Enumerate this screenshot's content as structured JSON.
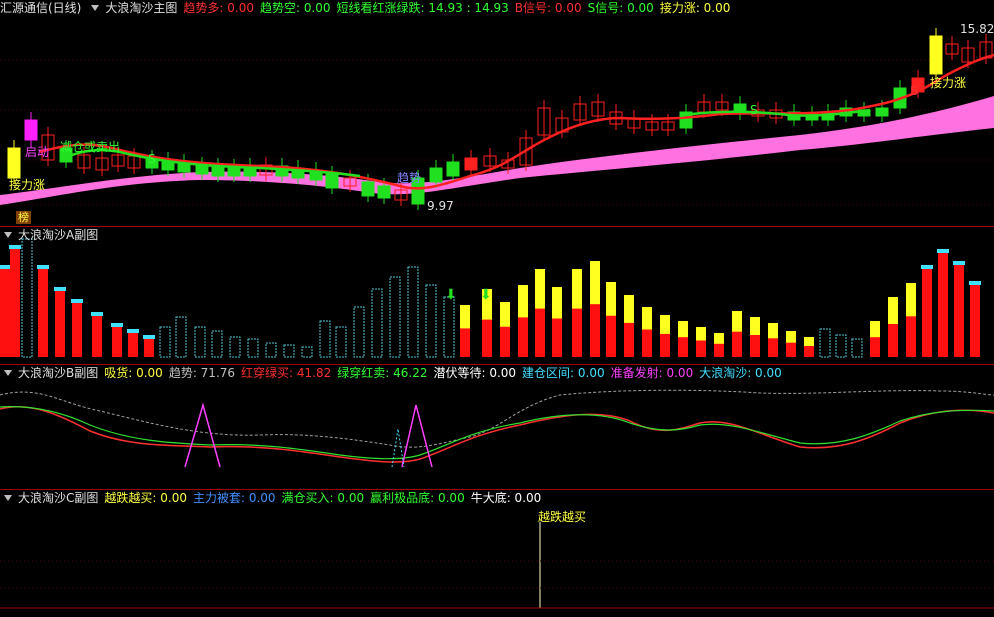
{
  "main": {
    "title": "汇源通信(日线)",
    "indicator": "大浪淘沙主图",
    "fields": [
      {
        "label": "趋势多:",
        "value": "0.00",
        "color": "#ff3030"
      },
      {
        "label": "趋势空:",
        "value": "0.00",
        "color": "#30ff30"
      },
      {
        "label": "短线看红涨绿跌:",
        "value": "14.93 : 14.93",
        "color": "#30ff30"
      },
      {
        "label": "B信号:",
        "value": "0.00",
        "color": "#ff3030"
      },
      {
        "label": "S信号:",
        "value": "0.00",
        "color": "#30ff30"
      },
      {
        "label": "接力涨:",
        "value": "0.00",
        "color": "#ffff40"
      }
    ],
    "annotations": {
      "jieli1": "接力涨",
      "jieli2": "接力涨",
      "qidong": "启动",
      "jiancang": "减仓或卖出",
      "qushi": "趋势",
      "bang": "榜",
      "low_price": "9.97",
      "high_price": "15.82",
      "b_mark": "B",
      "s_mark1": "S",
      "s_mark2": "S"
    }
  },
  "sub_a": {
    "title": "大浪淘沙A副图"
  },
  "sub_b": {
    "title": "大浪淘沙B副图",
    "fields": [
      {
        "label": "吸货:",
        "value": "0.00",
        "color": "#ffff40"
      },
      {
        "label": "趋势:",
        "value": "71.76",
        "color": "#c0c0c0"
      },
      {
        "label": "红穿绿买:",
        "value": "41.82",
        "color": "#ff3030"
      },
      {
        "label": "绿穿红卖:",
        "value": "46.22",
        "color": "#30ff30"
      },
      {
        "label": "潜伏等待:",
        "value": "0.00",
        "color": "#ffffff"
      },
      {
        "label": "建仓区间:",
        "value": "0.00",
        "color": "#40e0ff"
      },
      {
        "label": "准备发射:",
        "value": "0.00",
        "color": "#ff40ff"
      },
      {
        "label": "大浪淘沙:",
        "value": "0.00",
        "color": "#40e0ff"
      }
    ]
  },
  "sub_c": {
    "title": "大浪淘沙C副图",
    "fields": [
      {
        "label": "越跌越买:",
        "value": "0.00",
        "color": "#ffff40"
      },
      {
        "label": "主力被套:",
        "value": "0.00",
        "color": "#4090ff"
      },
      {
        "label": "满仓买入:",
        "value": "0.00",
        "color": "#30ff30"
      },
      {
        "label": "赢利极品底:",
        "value": "0.00",
        "color": "#30ff30"
      },
      {
        "label": "牛大底:",
        "value": "0.00",
        "color": "#ffffff"
      }
    ],
    "marker_label": "越跌越买"
  },
  "colors": {
    "up": "#ff2020",
    "down": "#20e020",
    "yellow": "#ffff20",
    "pink": "#ff70e0",
    "cyan": "#40e0ff",
    "sep": "#a00000"
  }
}
